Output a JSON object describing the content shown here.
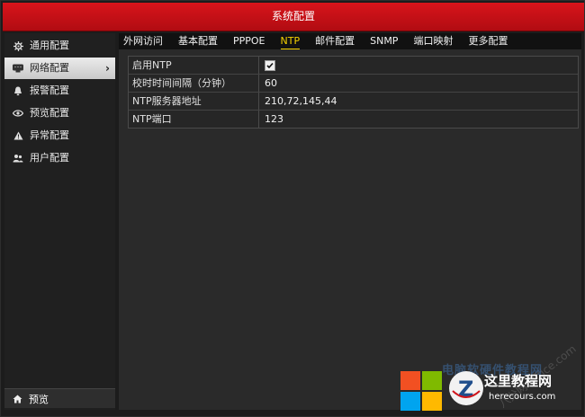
{
  "window": {
    "title": "系统配置"
  },
  "sidebar": {
    "items": [
      {
        "label": "通用配置",
        "icon": "gear-icon"
      },
      {
        "label": "网络配置",
        "icon": "network-icon",
        "active": true
      },
      {
        "label": "报警配置",
        "icon": "alarm-icon"
      },
      {
        "label": "预览配置",
        "icon": "eye-icon"
      },
      {
        "label": "异常配置",
        "icon": "warning-icon"
      },
      {
        "label": "用户配置",
        "icon": "users-icon"
      }
    ],
    "active_chevron": "›",
    "preview_label": "预览"
  },
  "tabs": [
    {
      "label": "外网访问"
    },
    {
      "label": "基本配置"
    },
    {
      "label": "PPPOE"
    },
    {
      "label": "NTP",
      "active": true
    },
    {
      "label": "邮件配置"
    },
    {
      "label": "SNMP"
    },
    {
      "label": "端口映射"
    },
    {
      "label": "更多配置"
    }
  ],
  "form": {
    "rows": [
      {
        "label": "启用NTP",
        "type": "checkbox",
        "checked": true
      },
      {
        "label": "校时时间间隔（分钟）",
        "value": "60"
      },
      {
        "label": "NTP服务器地址",
        "value": "210,72,145,44"
      },
      {
        "label": "NTP端口",
        "value": "123"
      }
    ]
  },
  "watermark": {
    "faint_text": "电脑软硬件教程网",
    "site_name": "这里教程网",
    "site_url": "herecours.com",
    "diagonal_text": "八分网 Office.com"
  },
  "colors": {
    "titlebar": "#c8111a",
    "active_tab": "#f5d000",
    "background": "#1c1c1c"
  }
}
